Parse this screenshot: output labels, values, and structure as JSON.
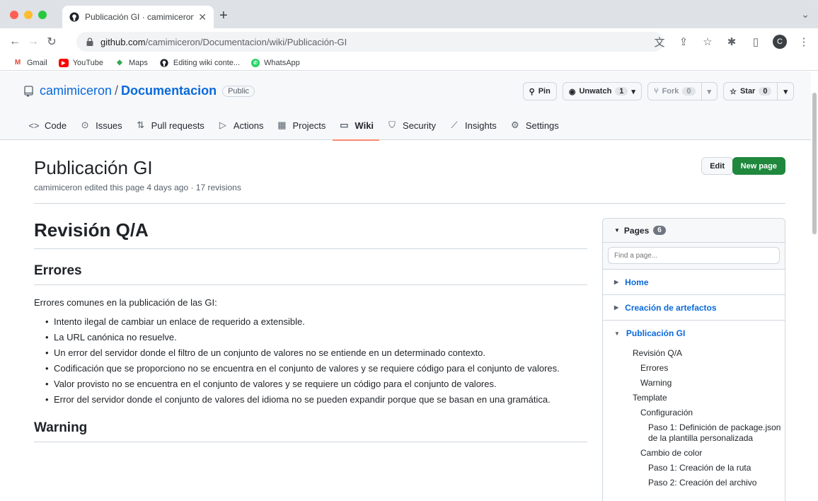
{
  "browser": {
    "tab_title": "Publicación GI · camimiceron/D",
    "new_tab": "+",
    "url_host": "github.com",
    "url_path": "/camimiceron/Documentacion/wiki/Publicación-GI",
    "avatar_letter": "C"
  },
  "bookmarks": [
    {
      "label": "Gmail",
      "icon": "gmail-icon"
    },
    {
      "label": "YouTube",
      "icon": "youtube-icon"
    },
    {
      "label": "Maps",
      "icon": "maps-icon"
    },
    {
      "label": "Editing wiki conte...",
      "icon": "github-icon"
    },
    {
      "label": "WhatsApp",
      "icon": "whatsapp-icon"
    }
  ],
  "repo": {
    "owner": "camimiceron",
    "separator": "/",
    "name": "Documentacion",
    "visibility": "Public",
    "pin_label": "Pin",
    "unwatch_label": "Unwatch",
    "unwatch_count": "1",
    "fork_label": "Fork",
    "fork_count": "0",
    "star_label": "Star",
    "star_count": "0"
  },
  "nav": [
    {
      "label": "Code",
      "icon": "code-icon"
    },
    {
      "label": "Issues",
      "icon": "issue-icon"
    },
    {
      "label": "Pull requests",
      "icon": "pull-request-icon"
    },
    {
      "label": "Actions",
      "icon": "play-icon"
    },
    {
      "label": "Projects",
      "icon": "table-icon"
    },
    {
      "label": "Wiki",
      "icon": "book-icon",
      "active": true
    },
    {
      "label": "Security",
      "icon": "shield-icon"
    },
    {
      "label": "Insights",
      "icon": "graph-icon"
    },
    {
      "label": "Settings",
      "icon": "gear-icon"
    }
  ],
  "page": {
    "title": "Publicación GI",
    "meta": "camimiceron edited this page 4 days ago · 17 revisions",
    "edit_label": "Edit",
    "new_page_label": "New page"
  },
  "article": {
    "h1": "Revisión Q/A",
    "h2_errors": "Errores",
    "intro": "Errores comunes en la publicación de las GI:",
    "items": [
      "Intento ilegal de cambiar un enlace de requerido a extensible.",
      "La URL canónica no resuelve.",
      "Un error del servidor donde el filtro de un conjunto de valores no se entiende en un determinado contexto.",
      "Codificación que se proporciono no se encuentra en el conjunto de valores y se requiere código para el conjunto de valores.",
      "Valor provisto no se encuentra en el conjunto de valores y se requiere un código para el conjunto de valores.",
      "Error del servidor donde el conjunto de valores del idioma no se pueden expandir porque que se basan en una gramática."
    ],
    "h2_warning": "Warning"
  },
  "sidebar": {
    "title": "Pages",
    "count": "6",
    "filter_placeholder": "Find a page...",
    "pages": [
      "Home",
      "Creación de artefactos",
      "Publicación GI"
    ],
    "toc": [
      {
        "label": "Revisión Q/A",
        "level": 1
      },
      {
        "label": "Errores",
        "level": 2
      },
      {
        "label": "Warning",
        "level": 2
      },
      {
        "label": "Template",
        "level": 1
      },
      {
        "label": "Configuración",
        "level": 2
      },
      {
        "label": "Paso 1: Definición de package.json de la plantilla personalizada",
        "level": 3
      },
      {
        "label": "Cambio de color",
        "level": 2
      },
      {
        "label": "Paso 1: Creación de la ruta",
        "level": 3
      },
      {
        "label": "Paso 2: Creación del archivo",
        "level": 3
      }
    ]
  },
  "colors": {
    "link": "#0969da",
    "primary_button": "#1f883d",
    "active_tab_underline": "#fd8c73"
  }
}
